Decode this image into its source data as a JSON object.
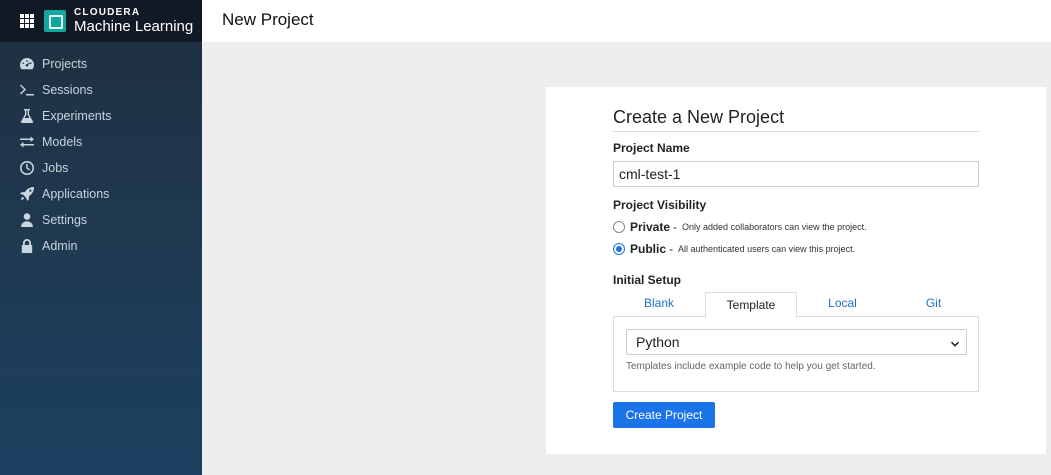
{
  "brand": {
    "app_menu_icon": "grid-icon",
    "company": "CLOUDERA",
    "product": "Machine Learning"
  },
  "sidebar": {
    "items": [
      {
        "label": "Projects",
        "icon": "gauge-icon"
      },
      {
        "label": "Sessions",
        "icon": "terminal-icon"
      },
      {
        "label": "Experiments",
        "icon": "flask-icon"
      },
      {
        "label": "Models",
        "icon": "swap-arrows-icon"
      },
      {
        "label": "Jobs",
        "icon": "clock-icon"
      },
      {
        "label": "Applications",
        "icon": "rocket-icon"
      },
      {
        "label": "Settings",
        "icon": "user-icon"
      },
      {
        "label": "Admin",
        "icon": "lock-icon"
      }
    ]
  },
  "header": {
    "title": "New Project"
  },
  "form": {
    "title": "Create a New Project",
    "name_label": "Project Name",
    "name_value": "cml-test-1",
    "visibility_label": "Project Visibility",
    "visibility_options": [
      {
        "title": "Private",
        "separator": "-",
        "description": "Only added collaborators can view the project.",
        "selected": false
      },
      {
        "title": "Public",
        "separator": "-",
        "description": "All authenticated users can view this project.",
        "selected": true
      }
    ],
    "setup_label": "Initial Setup",
    "tabs": [
      {
        "label": "Blank",
        "active": false
      },
      {
        "label": "Template",
        "active": true
      },
      {
        "label": "Local",
        "active": false
      },
      {
        "label": "Git",
        "active": false
      }
    ],
    "template_value": "Python",
    "template_help": "Templates include example code to help you get started.",
    "submit_label": "Create Project"
  },
  "colors": {
    "accent": "#1a73e8",
    "sidebar_top": "#1f2f3f",
    "sidebar_bottom": "#1c4160",
    "brand_bar": "#111a24",
    "logo": "#13a89e"
  }
}
